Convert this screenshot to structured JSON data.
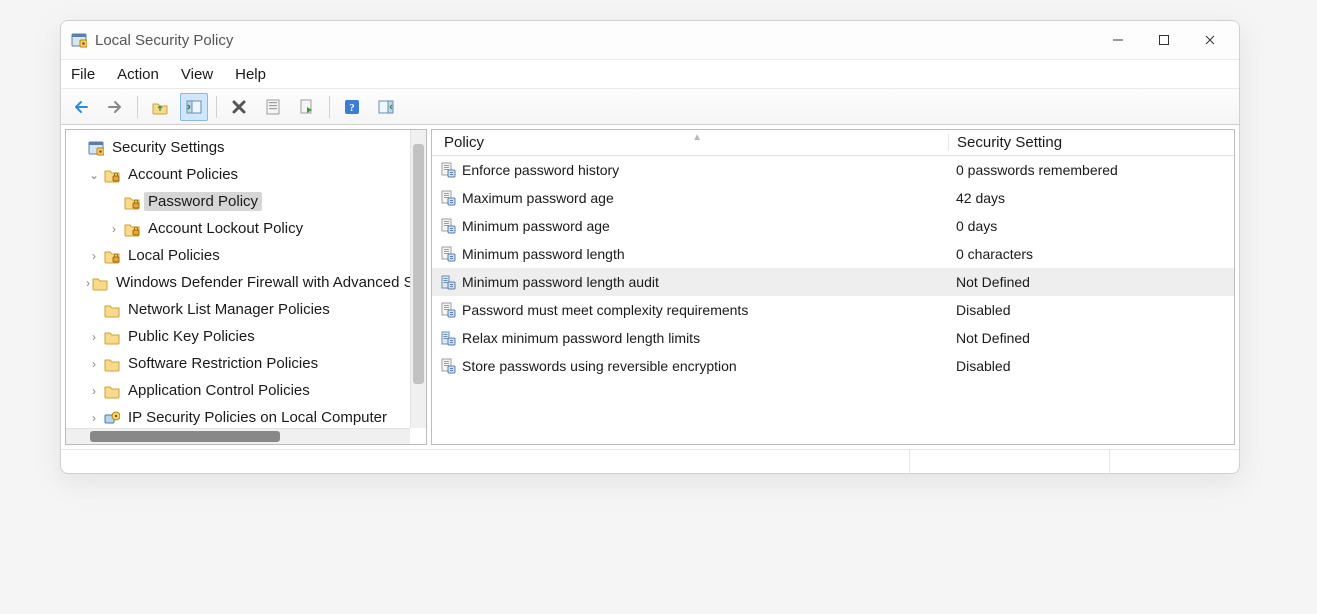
{
  "window": {
    "title": "Local Security Policy"
  },
  "menu": {
    "file": "File",
    "action": "Action",
    "view": "View",
    "help": "Help"
  },
  "tree": {
    "root": "Security Settings",
    "account_policies": "Account Policies",
    "password_policy": "Password Policy",
    "account_lockout_policy": "Account Lockout Policy",
    "local_policies": "Local Policies",
    "windows_defender_firewall": "Windows Defender Firewall with Advanced Security",
    "network_list_manager": "Network List Manager Policies",
    "public_key_policies": "Public Key Policies",
    "software_restriction": "Software Restriction Policies",
    "application_control": "Application Control Policies",
    "ip_security": "IP Security Policies on Local Computer"
  },
  "columns": {
    "policy": "Policy",
    "setting": "Security Setting"
  },
  "policies": [
    {
      "name": "Enforce password history",
      "value": "0 passwords remembered",
      "icon": "doc"
    },
    {
      "name": "Maximum password age",
      "value": "42 days",
      "icon": "doc"
    },
    {
      "name": "Minimum password age",
      "value": "0 days",
      "icon": "doc"
    },
    {
      "name": "Minimum password length",
      "value": "0 characters",
      "icon": "doc"
    },
    {
      "name": "Minimum password length audit",
      "value": "Not Defined",
      "icon": "server",
      "selected": true
    },
    {
      "name": "Password must meet complexity requirements",
      "value": "Disabled",
      "icon": "doc"
    },
    {
      "name": "Relax minimum password length limits",
      "value": "Not Defined",
      "icon": "server"
    },
    {
      "name": "Store passwords using reversible encryption",
      "value": "Disabled",
      "icon": "doc"
    }
  ]
}
